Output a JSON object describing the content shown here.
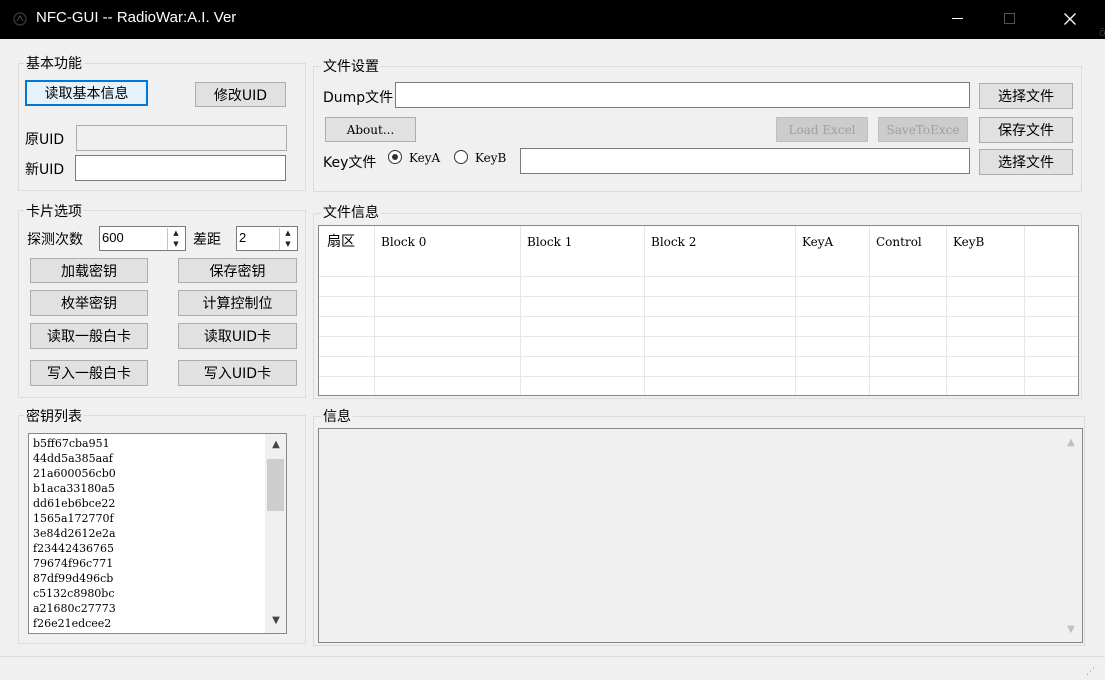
{
  "window": {
    "title": "NFC-GUI  -- RadioWar:A.I. Ver",
    "icon": "nfc-app-icon",
    "minimize_glyph": "—",
    "maximize_glyph": "☐",
    "close_glyph": "✕",
    "edge_glyph": "ō"
  },
  "basic": {
    "title": "基本功能",
    "read_info_button": "读取基本信息",
    "modify_uid_button": "修改UID",
    "old_uid_label": "原UID",
    "old_uid_value": "",
    "new_uid_label": "新UID",
    "new_uid_value": ""
  },
  "card": {
    "title": "卡片选项",
    "detect_label": "探测次数",
    "detect_value": "600",
    "gap_label": "差距",
    "gap_value": "2",
    "spin_up": "▲",
    "spin_down": "▼",
    "buttons": [
      "加载密钥",
      "保存密钥",
      "枚举密钥",
      "计算控制位",
      "读取一般白卡",
      "读取UID卡",
      "写入一般白卡",
      "写入UID卡"
    ]
  },
  "keys": {
    "title": "密钥列表",
    "items": [
      "b5ff67cba951",
      "44dd5a385aaf",
      "21a600056cb0",
      "b1aca33180a5",
      "dd61eb6bce22",
      "1565a172770f",
      "3e84d2612e2a",
      "f23442436765",
      "79674f96c771",
      "87df99d496cb",
      "c5132c8980bc",
      "a21680c27773",
      "f26e21edcee2"
    ],
    "scroll_up": "▲",
    "scroll_down": "▼"
  },
  "file": {
    "title": "文件设置",
    "dump_label": "Dump文件",
    "dump_value": "",
    "choose_file_1": "选择文件",
    "about_button": "About...",
    "load_excel_button": "Load Excel",
    "save_to_excel_button": "SaveToExce",
    "save_file_button": "保存文件",
    "key_label": "Key文件",
    "key_a_label": "KeyA",
    "key_b_label": "KeyB",
    "selected_key": "KeyA",
    "key_value": "",
    "choose_file_2": "选择文件"
  },
  "fileinfo": {
    "title": "文件信息",
    "columns": [
      "扇区",
      "Block 0",
      "Block 1",
      "Block 2",
      "KeyA",
      "Control",
      "KeyB"
    ],
    "rows": []
  },
  "info": {
    "title": "信息",
    "content": "",
    "scroll_up": "▲",
    "scroll_down": "▼"
  },
  "statusbar": {
    "grip": "⋰"
  }
}
